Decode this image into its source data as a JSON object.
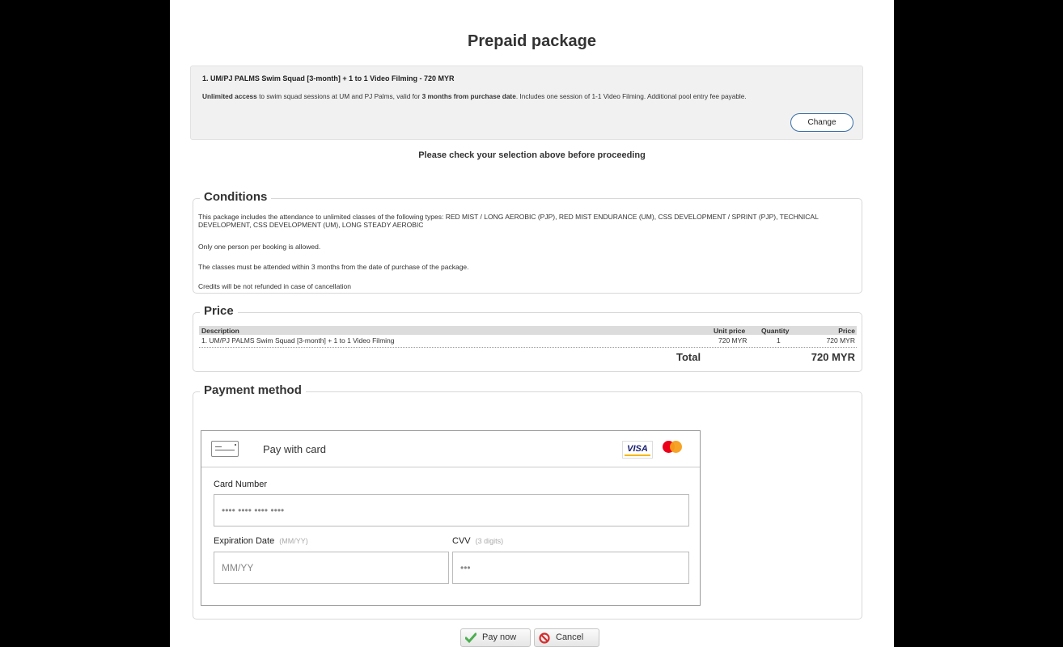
{
  "page": {
    "title": "Prepaid package"
  },
  "package": {
    "name": "1. UM/PJ PALMS Swim Squad [3-month] + 1 to 1 Video Filming - 720 MYR",
    "desc_bold1": "Unlimited access",
    "desc_text1": " to swim squad sessions at UM and PJ Palms, valid for ",
    "desc_bold2": "3 months from purchase date",
    "desc_text2": ". Includes one session of 1-1 Video Filming. Additional pool entry fee payable.",
    "change_label": "Change"
  },
  "check_message": "Please check your selection above before proceeding",
  "conditions": {
    "legend": "Conditions",
    "lines": [
      "This package includes the attendance to unlimited classes of the following types: RED MIST / LONG AEROBIC (PJP), RED MIST ENDURANCE (UM), CSS DEVELOPMENT / SPRINT (PJP), TECHNICAL DEVELOPMENT, CSS DEVELOPMENT (UM), LONG STEADY AEROBIC",
      "Only one person per booking is allowed.",
      "The classes must be attended within 3 months from the date of purchase of the package.",
      "Credits will be not refunded in case of cancellation"
    ]
  },
  "price": {
    "legend": "Price",
    "headers": {
      "description": "Description",
      "unit_price": "Unit price",
      "quantity": "Quantity",
      "price": "Price"
    },
    "row": {
      "description": "1. UM/PJ PALMS Swim Squad [3-month] + 1 to 1 Video Filming",
      "unit_price": "720 MYR",
      "quantity": "1",
      "price": "720 MYR"
    },
    "total_label": "Total",
    "total_value": "720 MYR"
  },
  "payment": {
    "legend": "Payment method",
    "card_title": "Pay with card",
    "visa": "VISA",
    "mastercard_text": "mastercard",
    "card_number_label": "Card Number",
    "card_number_placeholder": "•••• •••• •••• ••••",
    "expiration_label": "Expiration Date",
    "expiration_hint": "(MM/YY)",
    "expiration_placeholder": "MM/YY",
    "cvv_label": "CVV",
    "cvv_hint": "(3 digits)",
    "cvv_placeholder": "•••"
  },
  "actions": {
    "pay_now": "Pay now",
    "cancel": "Cancel"
  },
  "colors": {
    "accent_border": "#3a6fa8",
    "visa_blue": "#1a1f71",
    "mc_red": "#eb001b",
    "mc_orange": "#f79e1b",
    "check_green": "#4caf50",
    "cancel_red": "#d32f2f"
  }
}
